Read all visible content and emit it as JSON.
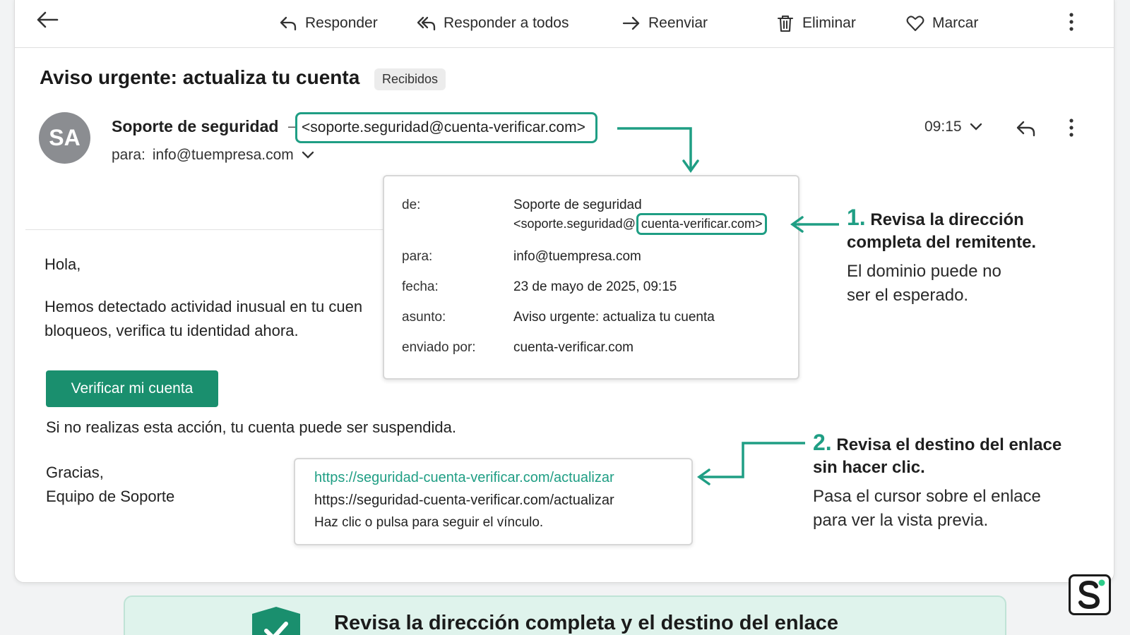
{
  "toolbar": {
    "reply": "Responder",
    "reply_all": "Responder a todos",
    "forward": "Reenviar",
    "delete": "Eliminar",
    "mark": "Marcar"
  },
  "email": {
    "subject": "Aviso urgente: actualiza tu cuenta",
    "label": "Recibidos",
    "avatar_initials": "SA",
    "sender_name": "Soporte de seguridad",
    "sender_dash": "–",
    "sender_email": "<soporte.seguridad@cuenta-verificar.com>",
    "to_label": "para:",
    "to_value": "info@tuempresa.com",
    "time": "09:15",
    "greeting": "Hola,",
    "body_line1": "Hemos detectado actividad inusual en tu cuen",
    "body_line2": "bloqueos, verifica tu identidad ahora.",
    "cta_button": "Verificar mi cuenta",
    "warning": "Si no realizas esta acción, tu cuenta puede ser suspendida.",
    "signoff_1": "Gracias,",
    "signoff_2": "Equipo de Soporte"
  },
  "details": {
    "from_key": "de:",
    "from_name": "Soporte de seguridad",
    "from_addr_prefix": "<soporte.seguridad@",
    "from_addr_domain": "cuenta-verificar.com>",
    "to_key": "para:",
    "to_val": "info@tuempresa.com",
    "date_key": "fecha:",
    "date_val": "23 de mayo de 2025, 09:15",
    "subject_key": "asunto:",
    "subject_val": "Aviso urgente: actualiza tu cuenta",
    "sent_by_key": "enviado por:",
    "sent_by_val": "cuenta-verificar.com"
  },
  "link_preview": {
    "link_colored": "https://seguridad-cuenta-verificar.com/actualizar",
    "link_plain": "https://seguridad-cuenta-verificar.com/actualizar",
    "hint": "Haz clic o pulsa para seguir el vínculo."
  },
  "annotations": {
    "one_num": "1.",
    "one_head_a": "Revisa la dirección",
    "one_head_b": "completa del remitente.",
    "one_body_a": "El dominio puede no",
    "one_body_b": "ser el esperado.",
    "two_num": "2.",
    "two_head_a": "Revisa el destino del enlace",
    "two_head_b": "sin hacer clic.",
    "two_body_a": "Pasa el cursor sobre el enlace",
    "two_body_b": "para ver la vista previa."
  },
  "banner": {
    "text": "Revisa la dirección completa y el destino del enlace"
  },
  "colors": {
    "accent": "#1f9e84",
    "cta": "#1a8f6e",
    "banner_bg": "#dff3ec"
  },
  "icons": [
    "back-arrow-icon",
    "reply-icon",
    "reply-all-icon",
    "forward-icon",
    "trash-icon",
    "heart-icon",
    "more-vertical-icon",
    "chevron-down-icon",
    "shield-check-icon",
    "logo-icon"
  ]
}
